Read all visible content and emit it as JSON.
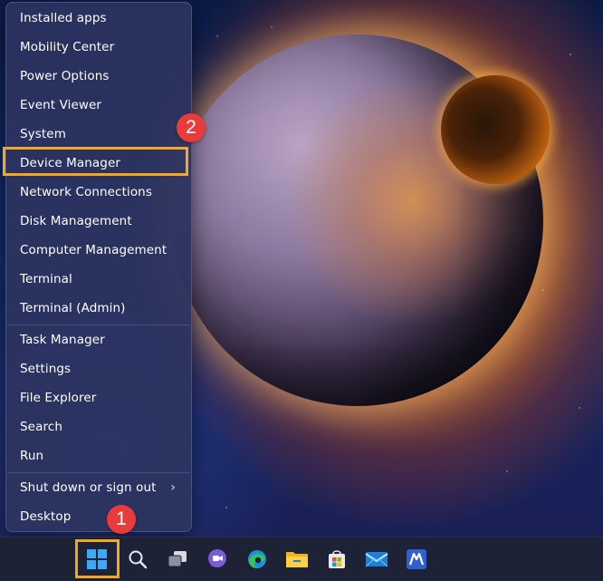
{
  "menu": {
    "items": [
      {
        "label": "Installed apps"
      },
      {
        "label": "Mobility Center"
      },
      {
        "label": "Power Options"
      },
      {
        "label": "Event Viewer"
      },
      {
        "label": "System"
      },
      {
        "label": "Device Manager"
      },
      {
        "label": "Network Connections"
      },
      {
        "label": "Disk Management"
      },
      {
        "label": "Computer Management"
      },
      {
        "label": "Terminal"
      },
      {
        "label": "Terminal (Admin)"
      },
      {
        "label": "Task Manager"
      },
      {
        "label": "Settings"
      },
      {
        "label": "File Explorer"
      },
      {
        "label": "Search"
      },
      {
        "label": "Run"
      },
      {
        "label": "Shut down or sign out",
        "chevron": "›"
      },
      {
        "label": "Desktop"
      }
    ]
  },
  "annotations": {
    "step1": "1",
    "step2": "2",
    "highlight_color": "#f5a623",
    "badge_color": "#ea3b3b"
  },
  "taskbar": {
    "icons": [
      "windows-start-icon",
      "search-icon",
      "task-view-icon",
      "chat-icon",
      "edge-browser-icon",
      "file-explorer-icon",
      "microsoft-store-icon",
      "mail-icon",
      "app-icon"
    ]
  }
}
